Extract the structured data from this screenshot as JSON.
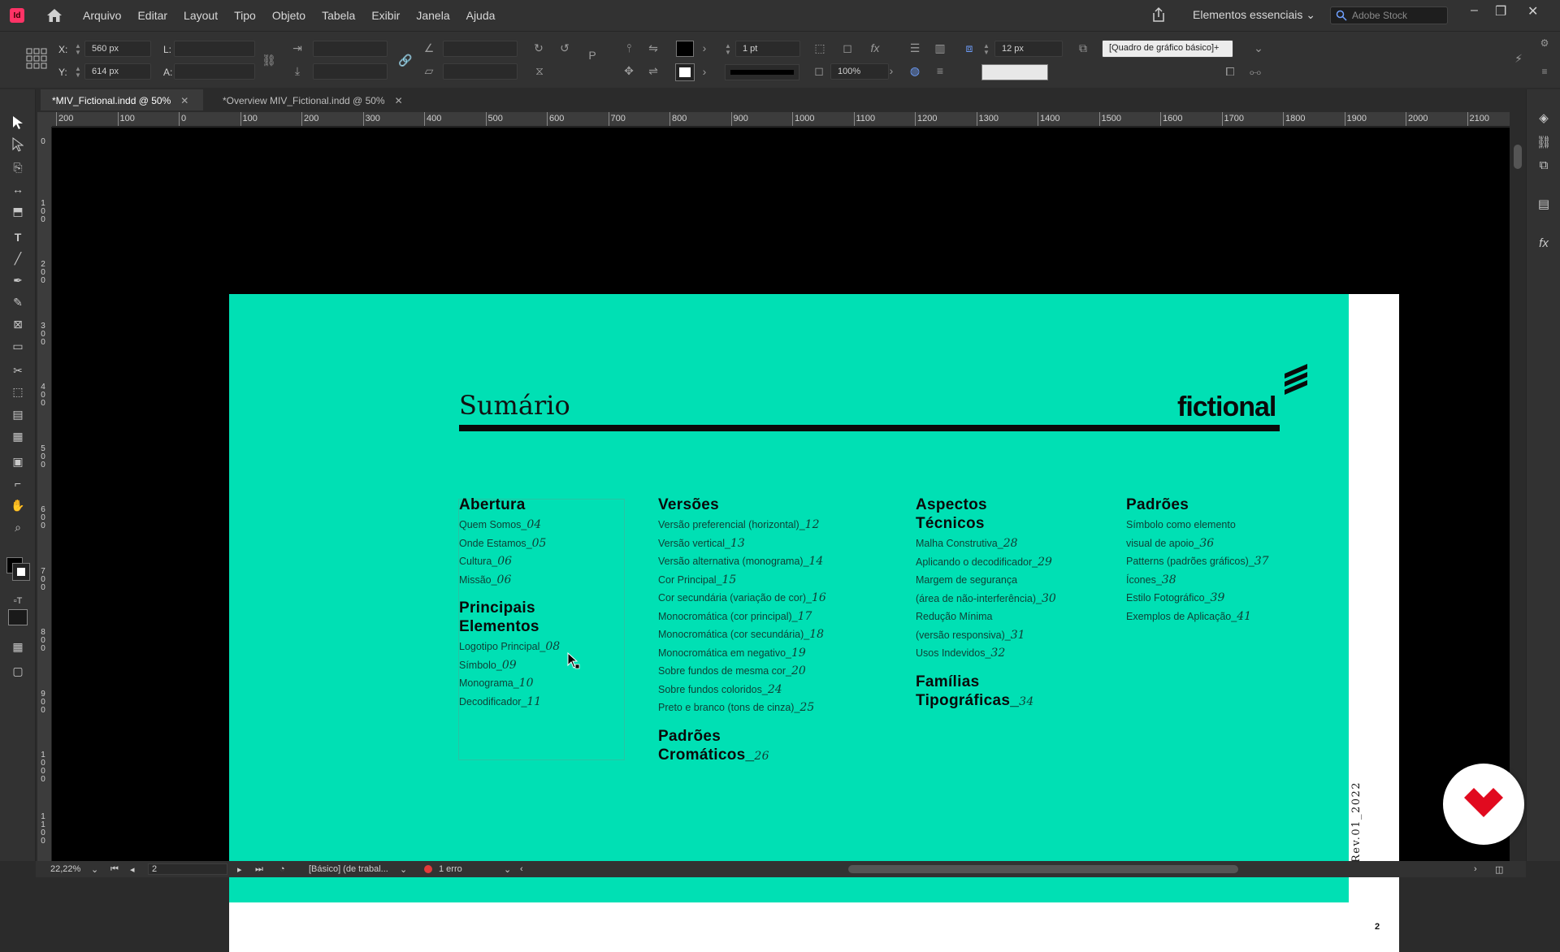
{
  "app": {
    "logo": "Id"
  },
  "menu": [
    "Arquivo",
    "Editar",
    "Layout",
    "Tipo",
    "Objeto",
    "Tabela",
    "Exibir",
    "Janela",
    "Ajuda"
  ],
  "workspace": "Elementos essenciais",
  "stock_search": {
    "placeholder": "Adobe Stock"
  },
  "control_bar": {
    "x_label": "X:",
    "x_value": "560 px",
    "y_label": "Y:",
    "y_value": "614 px",
    "w_label": "L:",
    "h_label": "A:",
    "stroke_weight": "1 pt",
    "zoom_percent": "100%",
    "gutter": "12 px",
    "object_style": "[Quadro de gráfico básico]+"
  },
  "tabs": [
    {
      "label": "*MIV_Fictional.indd @ 50%",
      "active": true
    },
    {
      "label": "*Overview MIV_Fictional.indd @ 50%",
      "active": false
    }
  ],
  "ruler": {
    "h": [
      "200",
      "100",
      "0",
      "100",
      "200",
      "300",
      "400",
      "500",
      "600",
      "700",
      "800",
      "900",
      "1000",
      "1100",
      "1200",
      "1300",
      "1400",
      "1500",
      "1600",
      "1700",
      "1800",
      "1900",
      "2000",
      "2100"
    ],
    "v": [
      "0",
      "100",
      "200",
      "300",
      "400",
      "500",
      "600",
      "700",
      "800",
      "900",
      "1000",
      "1100"
    ]
  },
  "page": {
    "title": "Sumário",
    "logo_text": "fictional",
    "revision": "Rev.01_2022",
    "number": "2",
    "colors": {
      "background": "#00e0b4",
      "text": "#0a0a0a"
    },
    "columns": [
      {
        "sections": [
          {
            "heading": "Abertura",
            "items": [
              {
                "label": "Quem Somos",
                "num": "04"
              },
              {
                "label": "Onde Estamos",
                "num": "05"
              },
              {
                "label": "Cultura",
                "num": "06"
              },
              {
                "label": "Missão",
                "num": "06"
              }
            ]
          },
          {
            "heading": "Principais Elementos",
            "items": [
              {
                "label": "Logotipo Principal",
                "num": "08"
              },
              {
                "label": "Símbolo",
                "num": "09"
              },
              {
                "label": "Monograma",
                "num": "10"
              },
              {
                "label": "Decodificador",
                "num": "11"
              }
            ]
          }
        ]
      },
      {
        "sections": [
          {
            "heading": "Versões",
            "items": [
              {
                "label": "Versão preferencial (horizontal)",
                "num": "12"
              },
              {
                "label": "Versão vertical",
                "num": "13"
              },
              {
                "label": "Versão alternativa (monograma)",
                "num": "14"
              },
              {
                "label": "Cor Principal",
                "num": "15"
              },
              {
                "label": "Cor secundária (variação de cor)",
                "num": "16"
              },
              {
                "label": "Monocromática (cor principal)",
                "num": "17"
              },
              {
                "label": "Monocromática (cor secundária)",
                "num": "18"
              },
              {
                "label": "Monocromática em negativo",
                "num": "19"
              },
              {
                "label": "Sobre fundos de mesma cor",
                "num": "20"
              },
              {
                "label": "Sobre fundos coloridos",
                "num": "24"
              },
              {
                "label": "Preto e branco (tons de cinza)",
                "num": "25"
              }
            ]
          },
          {
            "heading": "Padrões Cromáticos",
            "items": [],
            "num": "26"
          }
        ]
      },
      {
        "sections": [
          {
            "heading": "Aspectos Técnicos",
            "items": [
              {
                "label": "Malha Construtiva",
                "num": "28"
              },
              {
                "label": "Aplicando o decodificador",
                "num": "29"
              },
              {
                "label": "Margem de segurança",
                "num": ""
              },
              {
                "label": "(área de não-interferência)",
                "num": "30"
              },
              {
                "label": "Redução Mínima",
                "num": ""
              },
              {
                "label": "(versão responsiva)",
                "num": "31"
              },
              {
                "label": "Usos Indevidos",
                "num": "32"
              }
            ]
          },
          {
            "heading": "Famílias Tipográficas",
            "items": [],
            "num": "34"
          }
        ]
      },
      {
        "sections": [
          {
            "heading": "Padrões",
            "items": [
              {
                "label": "Símbolo como elemento",
                "num": ""
              },
              {
                "label": "visual de apoio",
                "num": "36"
              },
              {
                "label": "Patterns (padrões gráficos)",
                "num": "37"
              },
              {
                "label": "Ícones",
                "num": "38"
              },
              {
                "label": "Estilo Fotográfico",
                "num": "39"
              },
              {
                "label": "Exemplos de Aplicação",
                "num": "41"
              }
            ]
          }
        ]
      }
    ]
  },
  "status": {
    "zoom": "22,22%",
    "page": "2",
    "style": "[Básico] (de trabal...",
    "errors": "1 erro"
  }
}
